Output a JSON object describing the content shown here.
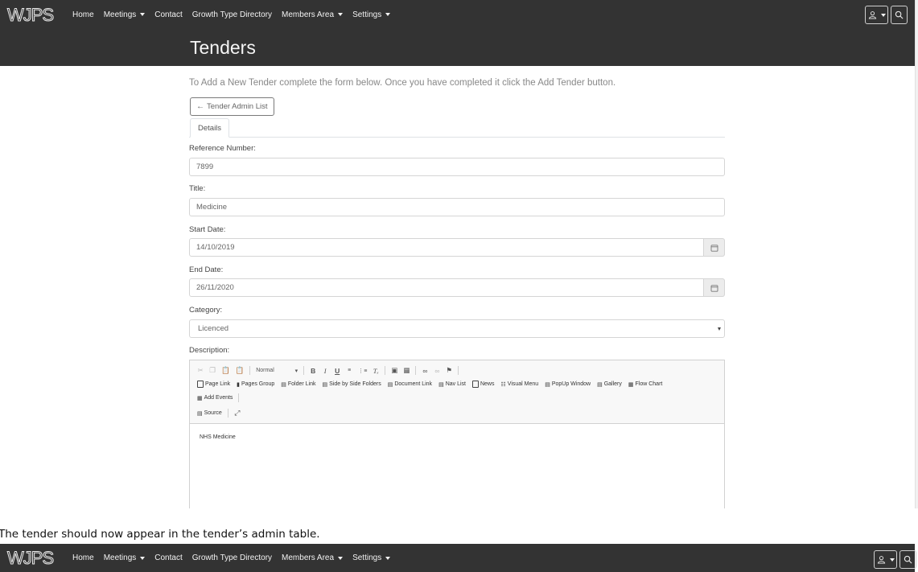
{
  "nav": {
    "items": [
      {
        "label": "Home",
        "dropdown": false
      },
      {
        "label": "Meetings",
        "dropdown": true
      },
      {
        "label": "Contact",
        "dropdown": false
      },
      {
        "label": "Growth Type Directory",
        "dropdown": false
      },
      {
        "label": "Members Area",
        "dropdown": true
      },
      {
        "label": "Settings",
        "dropdown": true
      }
    ],
    "logo_text": "WJPS",
    "user_icon": "user-icon",
    "search_icon": "search-icon"
  },
  "page": {
    "title": "Tenders",
    "intro": "To Add a New Tender complete the form below. Once you have completed it click the Add Tender button.",
    "back_button": "Tender Admin List",
    "tab": "Details"
  },
  "form": {
    "reference": {
      "label": "Reference Number:",
      "value": "7899"
    },
    "title": {
      "label": "Title:",
      "value": "Medicine"
    },
    "start_date": {
      "label": "Start Date:",
      "value": "14/10/2019"
    },
    "end_date": {
      "label": "End Date:",
      "value": "26/11/2020"
    },
    "category": {
      "label": "Category:",
      "value": "Licenced"
    },
    "description": {
      "label": "Description:",
      "value": "NHS Medicine"
    }
  },
  "editor": {
    "format_label": "Normal",
    "row2": [
      "Page Link",
      "Pages Group",
      "Folder Link",
      "Side by Side Folders",
      "Document Link",
      "Nav List",
      "News",
      "Visual Menu",
      "PopUp Window",
      "Gallery",
      "Flow Chart"
    ],
    "row3": [
      "Add Events"
    ],
    "source": "Source"
  },
  "caption": "The tender should now appear in the tender’s admin table.",
  "colors": {
    "navbar": "#333333",
    "text_muted": "#888888",
    "border": "#d5d5d5"
  }
}
